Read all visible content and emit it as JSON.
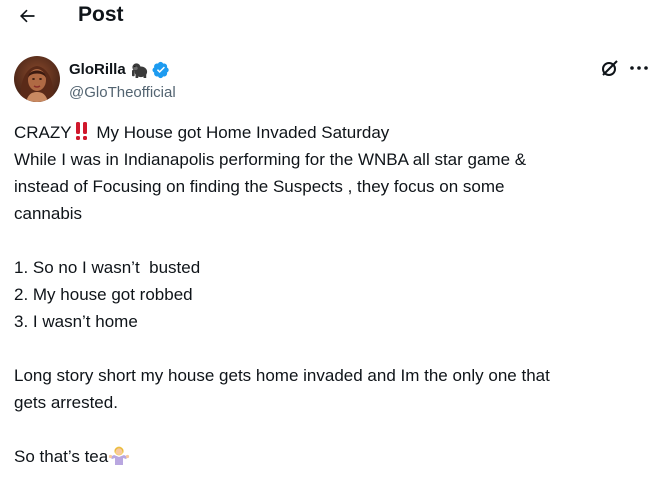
{
  "header": {
    "title": "Post",
    "back_icon": "arrow-left-icon"
  },
  "author": {
    "display_name": "GloRilla",
    "name_emoji": "gorilla-emoji",
    "verified_icon": "verified-badge-icon",
    "handle": "@GloTheofficial"
  },
  "top_actions": {
    "grok_icon": "grok-icon",
    "more_icon": "more-dots-icon"
  },
  "tweet": {
    "line1_prefix": "CRAZY",
    "line1_emoji": "double-exclamation-emoji",
    "line1_suffix": " My House got Home Invaded Saturday",
    "line2": "While I was in Indianapolis performing for the WNBA all star game &",
    "line3": "instead of Focusing on finding the Suspects , they focus on some",
    "line4": "cannabis",
    "list_item1": "1. So no I wasn’t  busted",
    "list_item2": "2. My house got robbed",
    "list_item3": "3. I wasn’t home",
    "para3_line1": "Long story short my house gets home invaded and Im the only one that",
    "para3_line2": "gets arrested.",
    "closing_text": "So that’s tea",
    "closing_emoji": "woman-shrugging-emoji"
  },
  "colors": {
    "text": "#0f1419",
    "secondary": "#536471",
    "verified": "#1d9bf0",
    "exclamation": "#d0182c"
  }
}
